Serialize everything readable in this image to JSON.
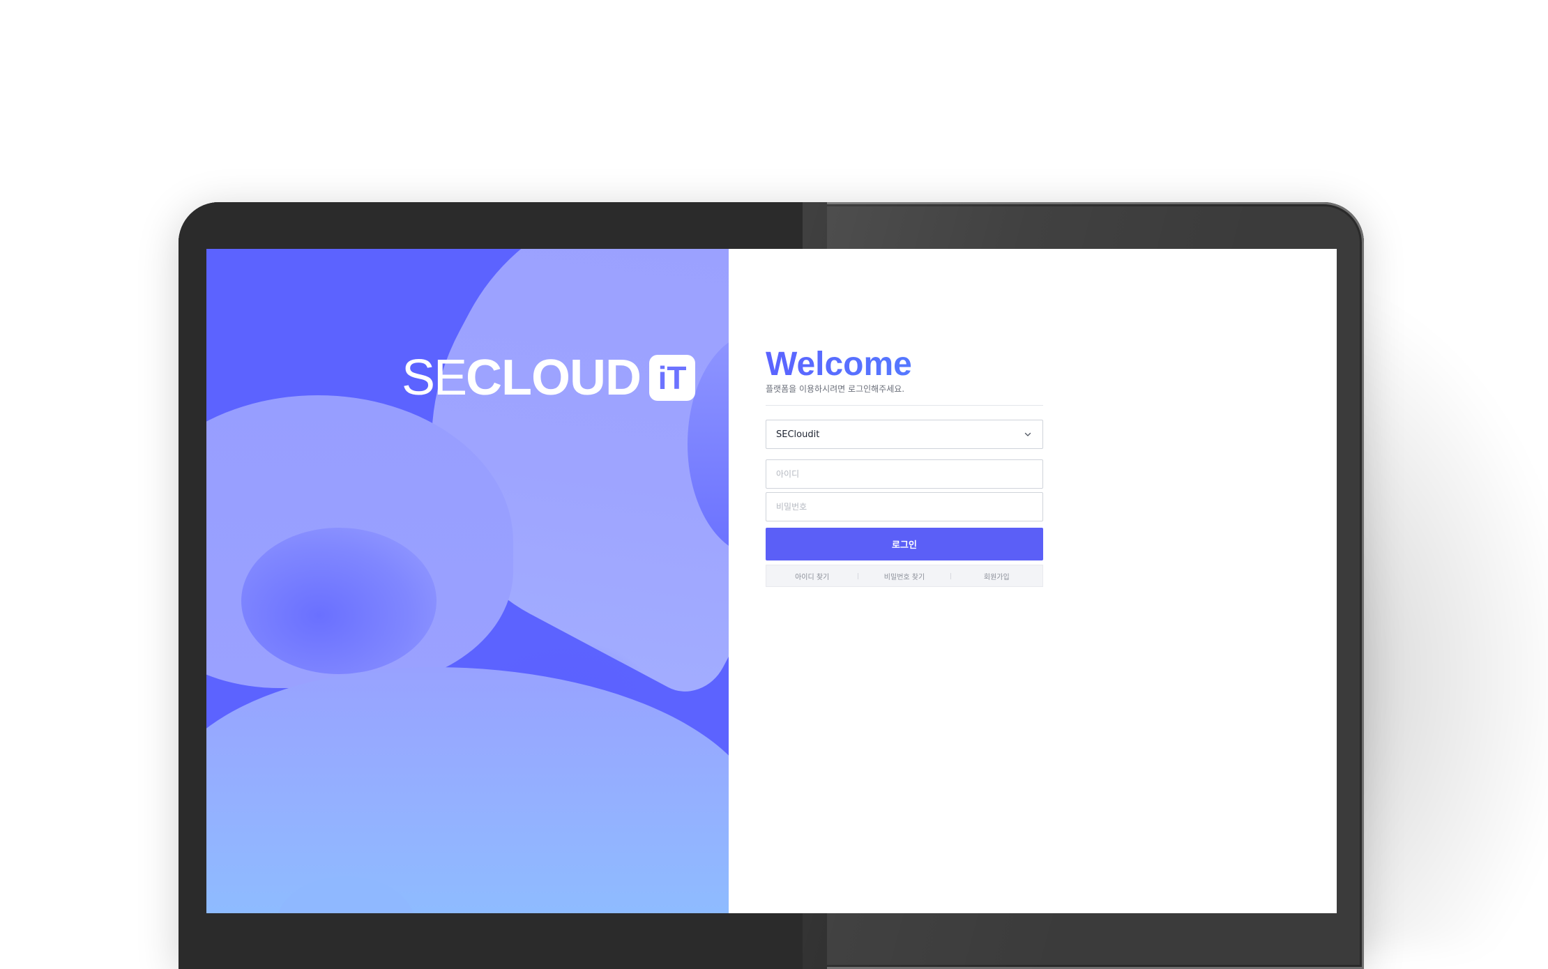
{
  "brand": {
    "logo_thin": "SE",
    "logo_bold": "CLOUD",
    "logo_badge": "iT",
    "accent_color": "#5b5ff7",
    "panel_color": "#5c63ff"
  },
  "login": {
    "title": "Welcome",
    "subtitle": "플랫폼을 이용하시려면 로그인해주세요.",
    "org_select": {
      "value": "SECloudit",
      "icon": "chevron-down-icon"
    },
    "id_field": {
      "placeholder": "아이디"
    },
    "password_field": {
      "placeholder": "비밀번호"
    },
    "login_button": "로그인",
    "links": {
      "find_id": "아이디 찾기",
      "find_password": "비밀번호 찾기",
      "signup": "회원가입"
    }
  }
}
